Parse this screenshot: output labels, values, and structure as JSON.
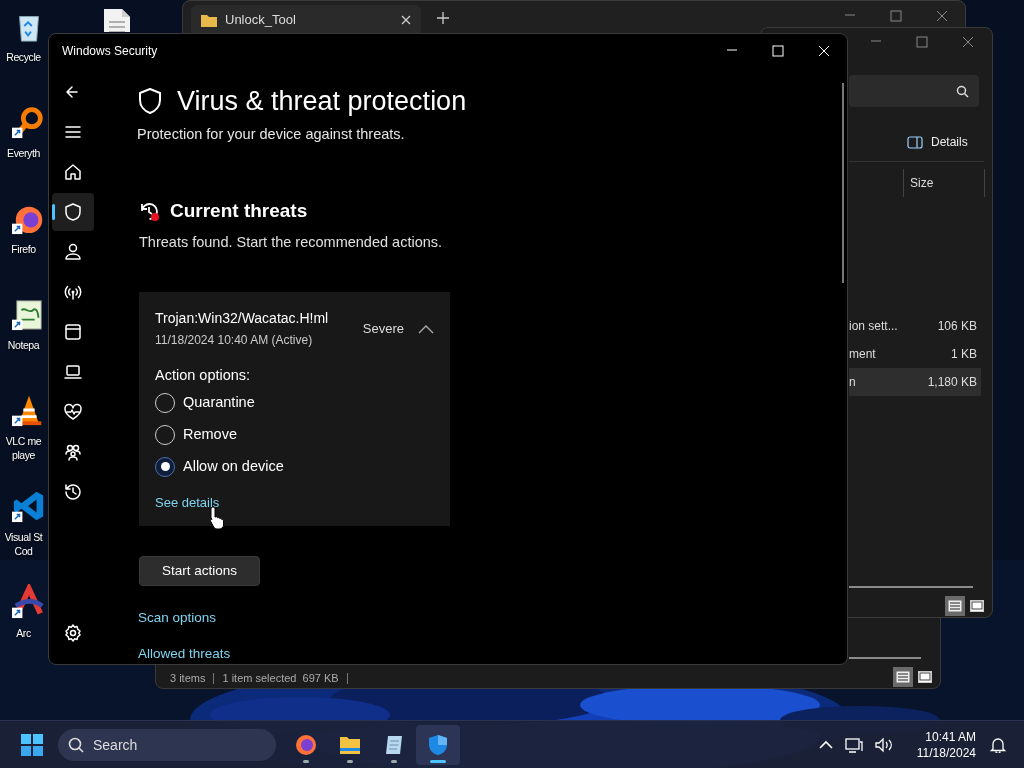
{
  "desktop_icons": [
    {
      "kind": "recycle",
      "lines": [
        "Recycle"
      ]
    },
    {
      "kind": "search",
      "lines": [
        "Everyth"
      ]
    },
    {
      "kind": "firefox",
      "lines": [
        "Firefo"
      ]
    },
    {
      "kind": "notepad",
      "lines": [
        "Notepa"
      ]
    },
    {
      "kind": "vlc",
      "lines": [
        "VLC me",
        "playe"
      ]
    },
    {
      "kind": "vscode",
      "lines": [
        "Visual St",
        "Cod"
      ]
    },
    {
      "kind": "arc",
      "lines": [
        "Arc"
      ]
    }
  ],
  "explorer_back": {
    "tab_title": "Unlock_Tool"
  },
  "explorer_front": {
    "toolbar_button": "Details",
    "columns": [
      "Size"
    ],
    "rows": [
      {
        "name": "ion sett...",
        "size": "106 KB",
        "selected": false
      },
      {
        "name": "ment",
        "size": "1 KB",
        "selected": false
      },
      {
        "name": "n",
        "size": "1,180 KB",
        "selected": true
      }
    ]
  },
  "explorer_bottom": {
    "status": [
      "3 items",
      "1 item selected  697 KB"
    ]
  },
  "security": {
    "title": "Windows Security",
    "nav": [
      {
        "kind": "back",
        "selected": false
      },
      {
        "kind": "menu",
        "selected": false
      },
      {
        "kind": "home",
        "selected": false
      },
      {
        "kind": "shield",
        "selected": true
      },
      {
        "kind": "person",
        "selected": false
      },
      {
        "kind": "wireless",
        "selected": false
      },
      {
        "kind": "browser",
        "selected": false
      },
      {
        "kind": "laptop",
        "selected": false
      },
      {
        "kind": "heart",
        "selected": false
      },
      {
        "kind": "family",
        "selected": false
      },
      {
        "kind": "history",
        "selected": false
      }
    ],
    "settings_nav": {
      "kind": "settings",
      "selected": false
    },
    "heading": "Virus & threat protection",
    "subtitle": "Protection for your device against threats.",
    "section_title": "Current threats",
    "section_text": "Threats found. Start the recommended actions.",
    "threat": {
      "name": "Trojan:Win32/Wacatac.H!ml",
      "date": "11/18/2024 10:40 AM (Active)",
      "severity": "Severe",
      "expanded": true,
      "action_label": "Action options:",
      "options": [
        {
          "label": "Quarantine",
          "selected": false
        },
        {
          "label": "Remove",
          "selected": false
        },
        {
          "label": "Allow on device",
          "selected": true
        }
      ],
      "link": "See details"
    },
    "button": "Start actions",
    "links": [
      "Scan options",
      "Allowed threats"
    ]
  },
  "taskbar": {
    "search_placeholder": "Search",
    "apps": [
      {
        "kind": "firefox",
        "active": false
      },
      {
        "kind": "folder",
        "active": false
      },
      {
        "kind": "notepad",
        "active": false
      },
      {
        "kind": "shield",
        "active": true
      }
    ],
    "time": "10:41 AM",
    "date": "11/18/2024"
  }
}
